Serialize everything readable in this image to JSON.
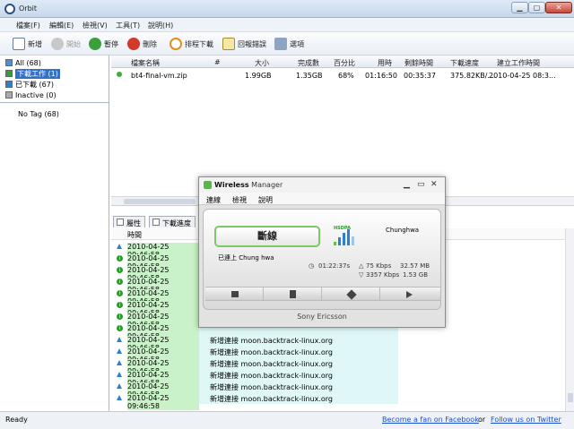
{
  "window": {
    "title": "Orbit",
    "min": "▁",
    "max": "▢",
    "close": "✕"
  },
  "menu": [
    "檔案(F)",
    "編輯(E)",
    "檢視(V)",
    "工具(T)",
    "說明(H)"
  ],
  "toolbar": {
    "new": "新增",
    "start": "開始",
    "pause": "暫停",
    "delete": "刪除",
    "schedule": "排程下載",
    "report": "回報錯誤",
    "options": "選項"
  },
  "tree": {
    "all": "All (68)",
    "downloading": "下載工作 (1)",
    "completed": "已下載 (67)",
    "inactive": "Inactive (0)",
    "notag": "No Tag (68)"
  },
  "grid": {
    "headers": {
      "name": "檔案名稱",
      "num": "#",
      "size": "大小",
      "done": "完成數",
      "percent": "百分比",
      "time": "用時",
      "remaining": "剩餘時間",
      "speed": "下載速度",
      "created": "建立工作時間"
    },
    "row": {
      "name": "bt4-final-vm.zip",
      "size": "1.99GB",
      "done": "1.35GB",
      "percent": "68%",
      "time": "01:16:50",
      "remaining": "00:35:37",
      "speed": "375.82KB/...",
      "created": "2010-04-25 08:3..."
    }
  },
  "tabs": {
    "props": "屬性",
    "progress": "下載進度"
  },
  "log": {
    "header": "時間",
    "rows": [
      {
        "time": "2010-04-25 09:46:58",
        "msg": "",
        "icon": "arrow"
      },
      {
        "time": "2010-04-25 09:46:58",
        "msg": "",
        "icon": "info"
      },
      {
        "time": "2010-04-25 09:46:58",
        "msg": "",
        "icon": "info"
      },
      {
        "time": "2010-04-25 09:46:58",
        "msg": "",
        "icon": "info"
      },
      {
        "time": "2010-04-25 09:46:58",
        "msg": "",
        "icon": "info"
      },
      {
        "time": "2010-04-25 09:46:58",
        "msg": "",
        "icon": "info"
      },
      {
        "time": "2010-04-25 09:46:58",
        "msg": "",
        "icon": "info"
      },
      {
        "time": "2010-04-25 09:46:58",
        "msg": "",
        "icon": "info"
      },
      {
        "time": "2010-04-25 09:46:58",
        "msg": "新增連接 moon.backtrack-linux.org",
        "icon": "arrow"
      },
      {
        "time": "2010-04-25 09:46:58",
        "msg": "新增連接 moon.backtrack-linux.org",
        "icon": "arrow"
      },
      {
        "time": "2010-04-25 09:46:58",
        "msg": "新增連接 moon.backtrack-linux.org",
        "icon": "arrow"
      },
      {
        "time": "2010-04-25 09:46:58",
        "msg": "新增連接 moon.backtrack-linux.org",
        "icon": "arrow"
      },
      {
        "time": "2010-04-25 09:46:58",
        "msg": "新增連接 moon.backtrack-linux.org",
        "icon": "arrow"
      },
      {
        "time": "2010-04-25 09:46:58",
        "msg": "新增連接 moon.backtrack-linux.org",
        "icon": "arrow"
      }
    ]
  },
  "status": {
    "ready": "Ready",
    "facebook": "Become a fan on Facebook",
    "or": "or",
    "twitter": "Follow us on Twitter"
  },
  "wireless": {
    "title_bold": "Wireless",
    "title_rest": " Manager",
    "menu": [
      "連線",
      "檢視",
      "說明"
    ],
    "disconnect": "斷線",
    "network_type": "HSDPA",
    "carrier": "Chunghwa",
    "connected": "已連上 Chung hwa",
    "duration": "01:22:37s",
    "up_rate": "75 Kbps",
    "up_total": "32.57 MB",
    "down_rate": "3357 Kbps",
    "down_total": "1.53 GB",
    "brand": "Sony Ericsson"
  }
}
